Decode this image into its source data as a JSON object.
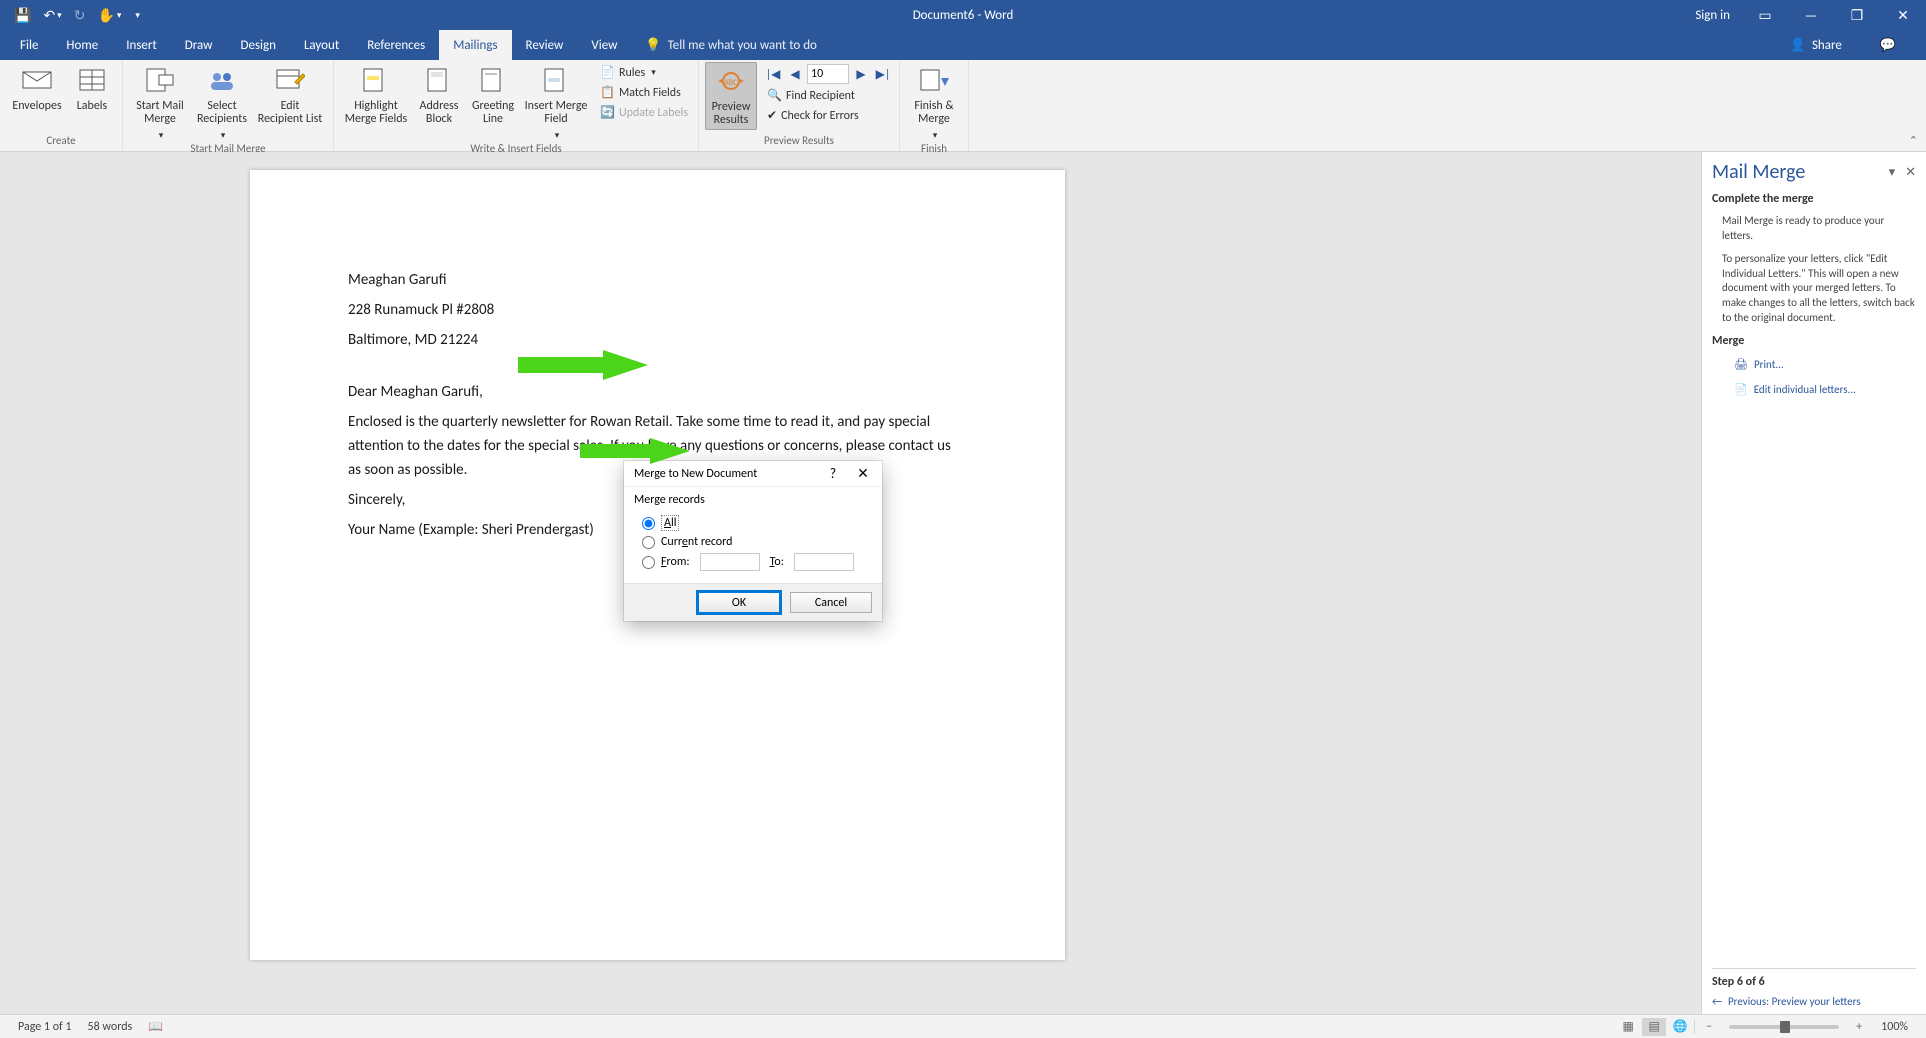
{
  "titlebar": {
    "title": "Document6  -  Word",
    "signin": "Sign in"
  },
  "tabs": {
    "file": "File",
    "home": "Home",
    "insert": "Insert",
    "draw": "Draw",
    "design": "Design",
    "layout": "Layout",
    "references": "References",
    "mailings": "Mailings",
    "review": "Review",
    "view": "View",
    "tellme": "Tell me what you want to do",
    "share": "Share"
  },
  "ribbon": {
    "create": {
      "label": "Create",
      "envelopes": "Envelopes",
      "labels": "Labels"
    },
    "startmm": {
      "label": "Start Mail Merge",
      "start": "Start Mail\nMerge",
      "select": "Select\nRecipients",
      "edit": "Edit\nRecipient List"
    },
    "write": {
      "label": "Write & Insert Fields",
      "highlight": "Highlight\nMerge Fields",
      "address": "Address\nBlock",
      "greeting": "Greeting\nLine",
      "insertmf": "Insert Merge\nField",
      "rules": "Rules",
      "match": "Match Fields",
      "update": "Update Labels"
    },
    "preview": {
      "label": "Preview Results",
      "btn": "Preview\nResults",
      "rec": "10",
      "find": "Find Recipient",
      "check": "Check for Errors"
    },
    "finish": {
      "label": "Finish",
      "btn": "Finish &\nMerge"
    }
  },
  "doc": {
    "name": "Meaghan Garufi",
    "addr1": "228 Runamuck Pl #2808",
    "addr2": "Baltimore, MD 21224",
    "salut": "Dear Meaghan Garufi,",
    "body": "Enclosed is the quarterly newsletter for Rowan Retail. Take some time to read it, and pay special attention to the dates for the special sales. If you have any questions or concerns, please contact us as soon as possible.",
    "closing": "Sincerely,",
    "signature": "Your Name (Example: Sheri Prendergast)"
  },
  "dialog": {
    "title": "Merge to New Document",
    "group": "Merge records",
    "optAll": "All",
    "optCurrent": "Current record",
    "optFrom": "From:",
    "optTo": "To:",
    "ok": "OK",
    "cancel": "Cancel"
  },
  "pane": {
    "title": "Mail Merge",
    "secComplete": "Complete the merge",
    "p1": "Mail Merge is ready to produce your letters.",
    "p2": "To personalize your letters, click \"Edit Individual Letters.\" This will open a new document with your merged letters. To make changes to all the letters, switch back to the original document.",
    "secMerge": "Merge",
    "linkPrint": "Print...",
    "linkEdit": "Edit individual letters...",
    "step": "Step 6 of 6",
    "prev": "Previous: Preview your letters"
  },
  "statusbar": {
    "page": "Page 1 of 1",
    "words": "58 words",
    "zoom": "100%"
  }
}
